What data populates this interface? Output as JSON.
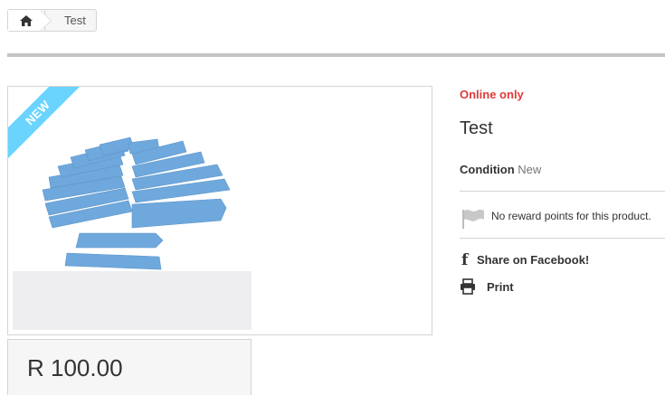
{
  "breadcrumb": {
    "home_icon": "home-icon",
    "current": "Test"
  },
  "product": {
    "badge": "NEW",
    "online_only": "Online only",
    "title": "Test",
    "condition_label": "Condition",
    "condition_value": "New",
    "reward_text": "No reward points for this product.",
    "share_facebook": "Share on Facebook!",
    "print": "Print",
    "price": "R 100.00"
  },
  "colors": {
    "accent_red": "#de3a3a",
    "badge_blue": "#6ad4ff",
    "product_blue": "#6fa8dc"
  }
}
